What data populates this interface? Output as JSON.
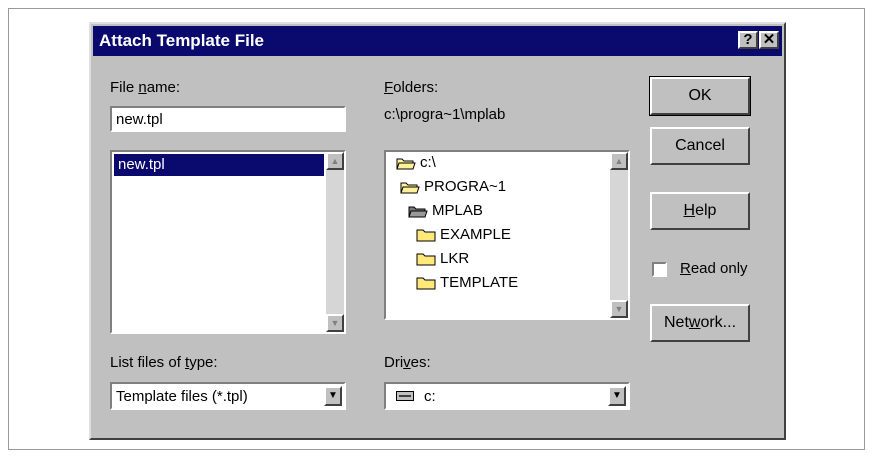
{
  "dialog": {
    "title": "Attach Template File",
    "help_btn": "?",
    "close_btn": "✕"
  },
  "file_name": {
    "label_pre": "File ",
    "label_u": "n",
    "label_post": "ame:",
    "value": "new.tpl",
    "list": [
      "new.tpl"
    ]
  },
  "folders": {
    "label_u": "F",
    "label_post": "olders:",
    "path": "c:\\progra~1\\mplab",
    "tree": [
      {
        "name": "c:\\",
        "icon": "open-folder-icon"
      },
      {
        "name": "PROGRA~1",
        "icon": "open-folder-icon"
      },
      {
        "name": "MPLAB",
        "icon": "open-folder-icon"
      },
      {
        "name": "EXAMPLE",
        "icon": "folder-icon"
      },
      {
        "name": "LKR",
        "icon": "folder-icon"
      },
      {
        "name": "TEMPLATE",
        "icon": "folder-icon"
      }
    ]
  },
  "list_type": {
    "label_pre": "List files of ",
    "label_u": "t",
    "label_post": "ype:",
    "value": "Template files (*.tpl)"
  },
  "drives": {
    "label_pre": "Dri",
    "label_u": "v",
    "label_post": "es:",
    "value": "c:"
  },
  "buttons": {
    "ok": "OK",
    "cancel": "Cancel",
    "help_u": "H",
    "help_post": "elp",
    "network_pre": "Net",
    "network_u": "w",
    "network_post": "ork..."
  },
  "read_only": {
    "label_u": "R",
    "label_post": "ead only",
    "checked": false
  }
}
